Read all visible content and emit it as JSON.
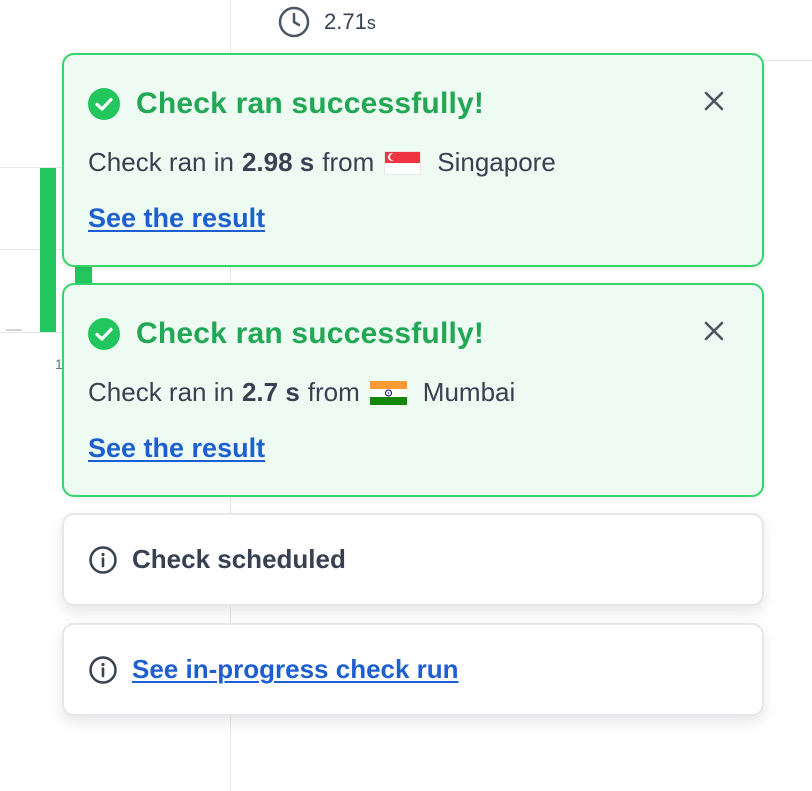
{
  "background": {
    "timing_value": "2.71",
    "timing_unit": "s",
    "axis_fragment": "1"
  },
  "toasts": [
    {
      "type": "success",
      "title": "Check ran successfully!",
      "body_prefix": "Check ran in",
      "duration": "2.98 s",
      "body_from": "from",
      "location": "Singapore",
      "flag": "singapore-flag",
      "link_label": "See the result"
    },
    {
      "type": "success",
      "title": "Check ran successfully!",
      "body_prefix": "Check ran in",
      "duration": "2.7 s",
      "body_from": "from",
      "location": "Mumbai",
      "flag": "india-flag",
      "link_label": "See the result"
    },
    {
      "type": "info",
      "text": "Check scheduled"
    },
    {
      "type": "info-link",
      "link_label": "See in-progress check run"
    }
  ],
  "colors": {
    "success_green": "#22a755",
    "success_border": "#34d56a",
    "success_bg": "#edfbf2",
    "link_blue": "#1d5fd1",
    "bar_green": "#22c55e"
  },
  "icons": [
    "clock-icon",
    "check-circle-icon",
    "close-icon",
    "info-icon"
  ]
}
